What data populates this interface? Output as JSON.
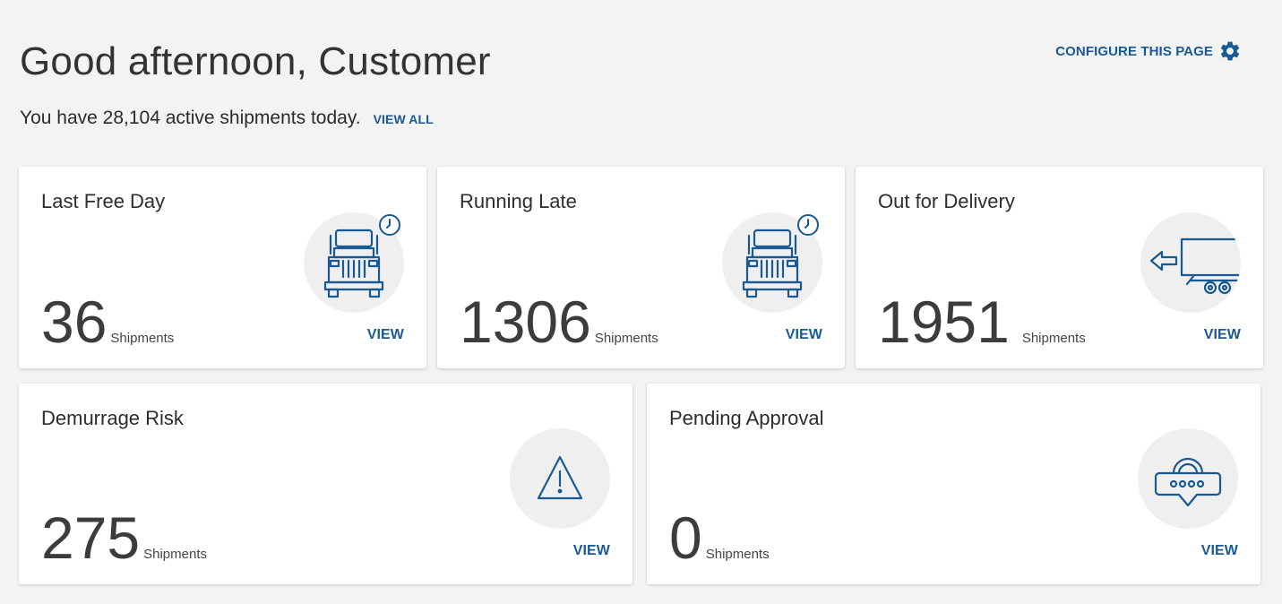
{
  "header": {
    "greeting": "Good afternoon, Customer",
    "summary": "You have 28,104 active shipments today.",
    "view_all_label": "VIEW ALL",
    "configure_label": "CONFIGURE THIS PAGE",
    "configure_icon": "gear-icon"
  },
  "colors": {
    "accent": "#1a5a93",
    "background": "#f3f3f3",
    "card": "#ffffff",
    "icon_circle": "#efefef"
  },
  "cards": [
    {
      "title": "Last Free Day",
      "count": "36",
      "unit": "Shipments",
      "view_label": "VIEW",
      "icon": "truck-clock-icon"
    },
    {
      "title": "Running Late",
      "count": "1306",
      "unit": "Shipments",
      "view_label": "VIEW",
      "icon": "truck-clock-icon"
    },
    {
      "title": "Out for Delivery",
      "count": "1951",
      "unit": "Shipments",
      "view_label": "VIEW",
      "icon": "trailer-arrow-icon"
    },
    {
      "title": "Demurrage Risk",
      "count": "275",
      "unit": "Shipments",
      "view_label": "VIEW",
      "icon": "warning-triangle-icon"
    },
    {
      "title": "Pending Approval",
      "count": "0",
      "unit": "Shipments",
      "view_label": "VIEW",
      "icon": "password-lock-icon"
    }
  ]
}
